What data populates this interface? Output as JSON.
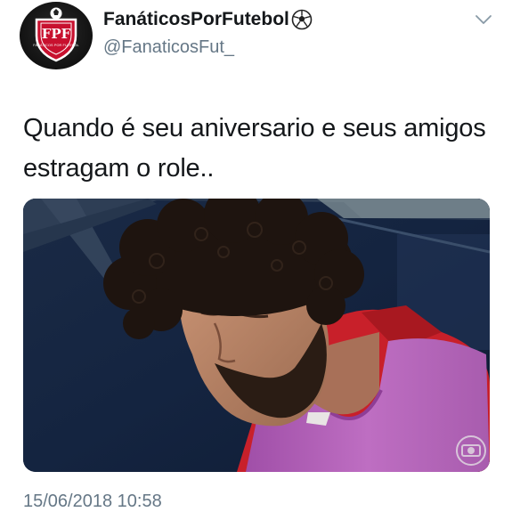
{
  "author": {
    "display_name": "FanáticosPorFutebol",
    "handle": "@FanaticosFut_",
    "avatar_text": "FPF",
    "avatar_subtext": "FANÁTICOS POR FUTEBOL",
    "name_emoji_icon": "soccer-ball-icon"
  },
  "menu_icon": "chevron-down-icon",
  "tweet": {
    "text": "Quando é seu aniversario e seus amigos estragam o role..",
    "timestamp": "15/06/2018 10:58"
  },
  "media": {
    "watermark_icon": "globo-logo-icon"
  },
  "colors": {
    "text_primary": "#14171a",
    "text_secondary": "#657786",
    "avatar_red": "#c8102e",
    "bib_purple": "#b35fb8",
    "jersey_red": "#c8202a"
  }
}
